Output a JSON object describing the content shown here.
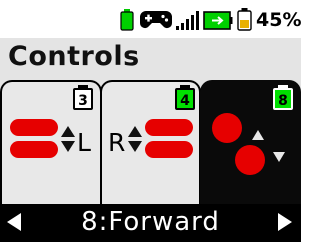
{
  "status_bar": {
    "battery_percent": "45%",
    "battery_level": 0.45,
    "icons": [
      "battery-small-icon",
      "gamepad-icon",
      "signal-bars-icon",
      "battery-charging-icon",
      "battery-icon"
    ]
  },
  "title": "Controls",
  "tabs": [
    {
      "badge": "3",
      "direction_label": "L",
      "badge_color": "#ffffff",
      "active": false
    },
    {
      "badge": "4",
      "direction_label": "R",
      "badge_color": "#00e000",
      "active": false
    },
    {
      "badge": "8",
      "badge_color": "#00e000",
      "active": true
    }
  ],
  "footer": {
    "mode_label": "8:Forward"
  },
  "colors": {
    "accent_red": "#e60000",
    "badge_green": "#00e000",
    "dark": "#0a0a0a"
  }
}
